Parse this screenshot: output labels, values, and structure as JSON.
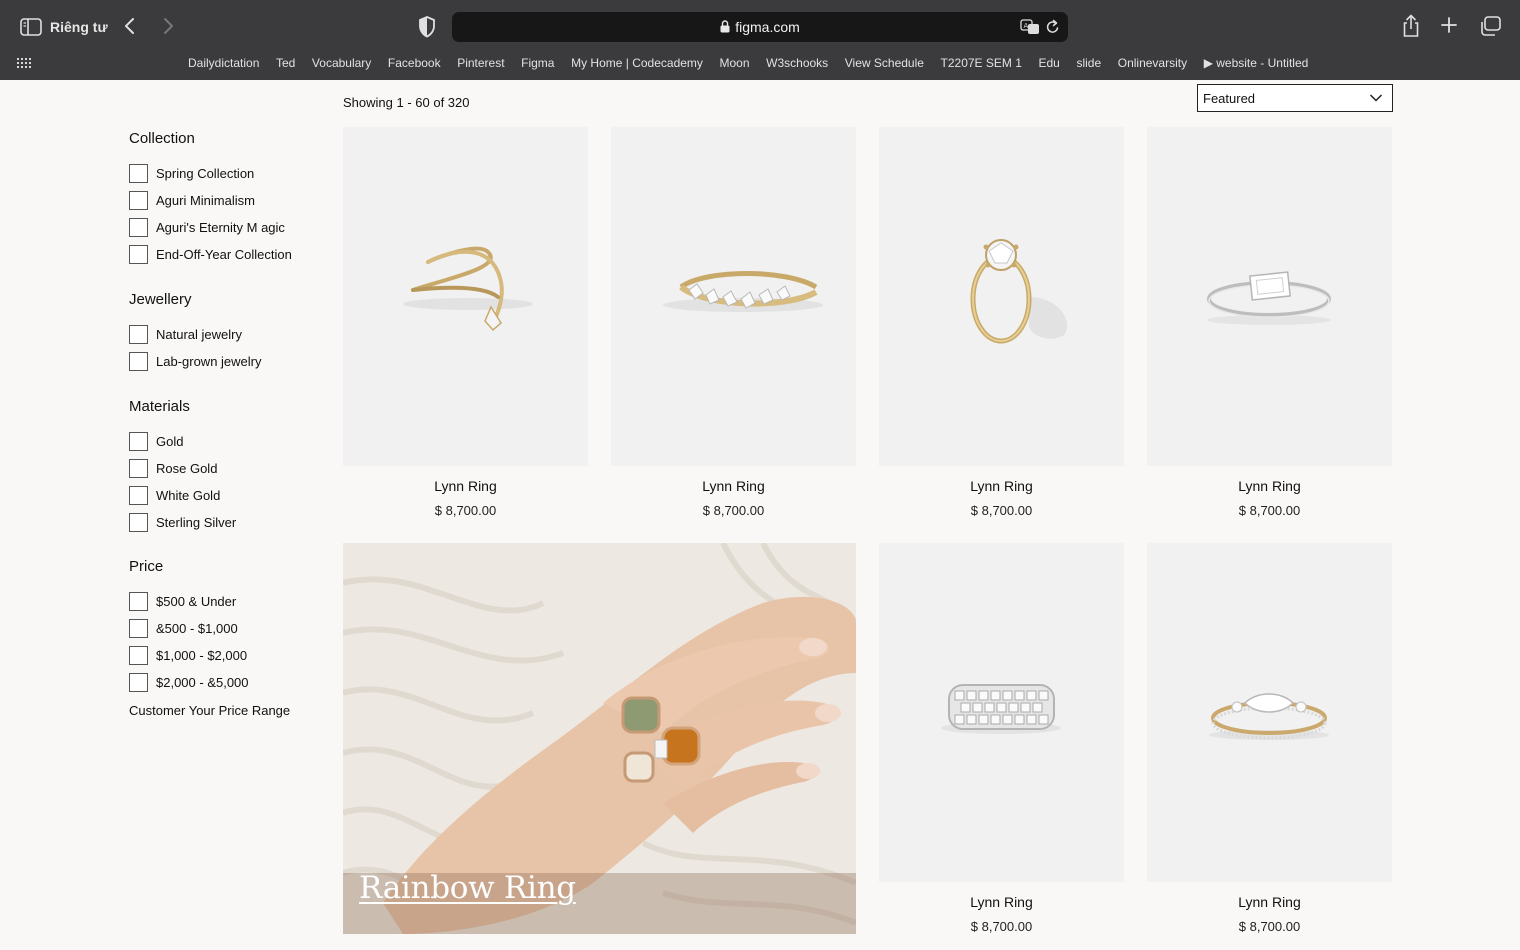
{
  "browser": {
    "profile_label": "Riêng tư",
    "url": "figma.com",
    "bookmarks": [
      "Dailydictation",
      "Ted",
      "Vocabulary",
      "Facebook",
      "Pinterest",
      "Figma",
      "My Home | Codecademy",
      "Moon",
      "W3schooks",
      "View Schedule",
      "T2207E SEM 1",
      "Edu",
      "slide",
      "Onlinevarsity",
      "▶ website - Untitled"
    ]
  },
  "listing": {
    "showing": "Showing 1 - 60 of 320",
    "sort_value": "Featured"
  },
  "filters": {
    "collection": {
      "title": "Collection",
      "options": [
        "Spring Collection",
        "Aguri Minimalism",
        "Aguri's Eternity M agic",
        "End-Off-Year Collection"
      ]
    },
    "jewellery": {
      "title": "Jewellery",
      "options": [
        "Natural jewelry",
        "Lab-grown jewelry"
      ]
    },
    "materials": {
      "title": "Materials",
      "options": [
        "Gold",
        "Rose Gold",
        "White Gold",
        "Sterling Silver"
      ]
    },
    "price": {
      "title": "Price",
      "options": [
        "$500 & Under",
        "&500 - $1,000",
        "$1,000 - $2,000",
        "$2,000 - &5,000"
      ],
      "custom": "Customer Your Price Range"
    }
  },
  "products": [
    {
      "name": "Lynn Ring",
      "price": "$ 8,700.00",
      "image": "gold-spiral-ring"
    },
    {
      "name": "Lynn Ring",
      "price": "$ 8,700.00",
      "image": "gold-diamond-band"
    },
    {
      "name": "Lynn Ring",
      "price": "$ 8,700.00",
      "image": "gold-solitaire-ring"
    },
    {
      "name": "Lynn Ring",
      "price": "$ 8,700.00",
      "image": "white-gold-emerald-cut-ring"
    },
    {
      "name": "Lynn Ring",
      "price": "$ 8,700.00",
      "image": "white-gold-wide-band"
    },
    {
      "name": "Lynn Ring",
      "price": "$ 8,700.00",
      "image": "two-tone-marquise-ring"
    }
  ],
  "banner": {
    "title": "Rainbow Ring",
    "image": "hand-wearing-stacked-gem-rings"
  },
  "colors": {
    "chrome": "#3b3b3d",
    "address_bar": "#171717",
    "page_bg": "#f9f8f6",
    "card_bg": "#f1f1f1"
  }
}
